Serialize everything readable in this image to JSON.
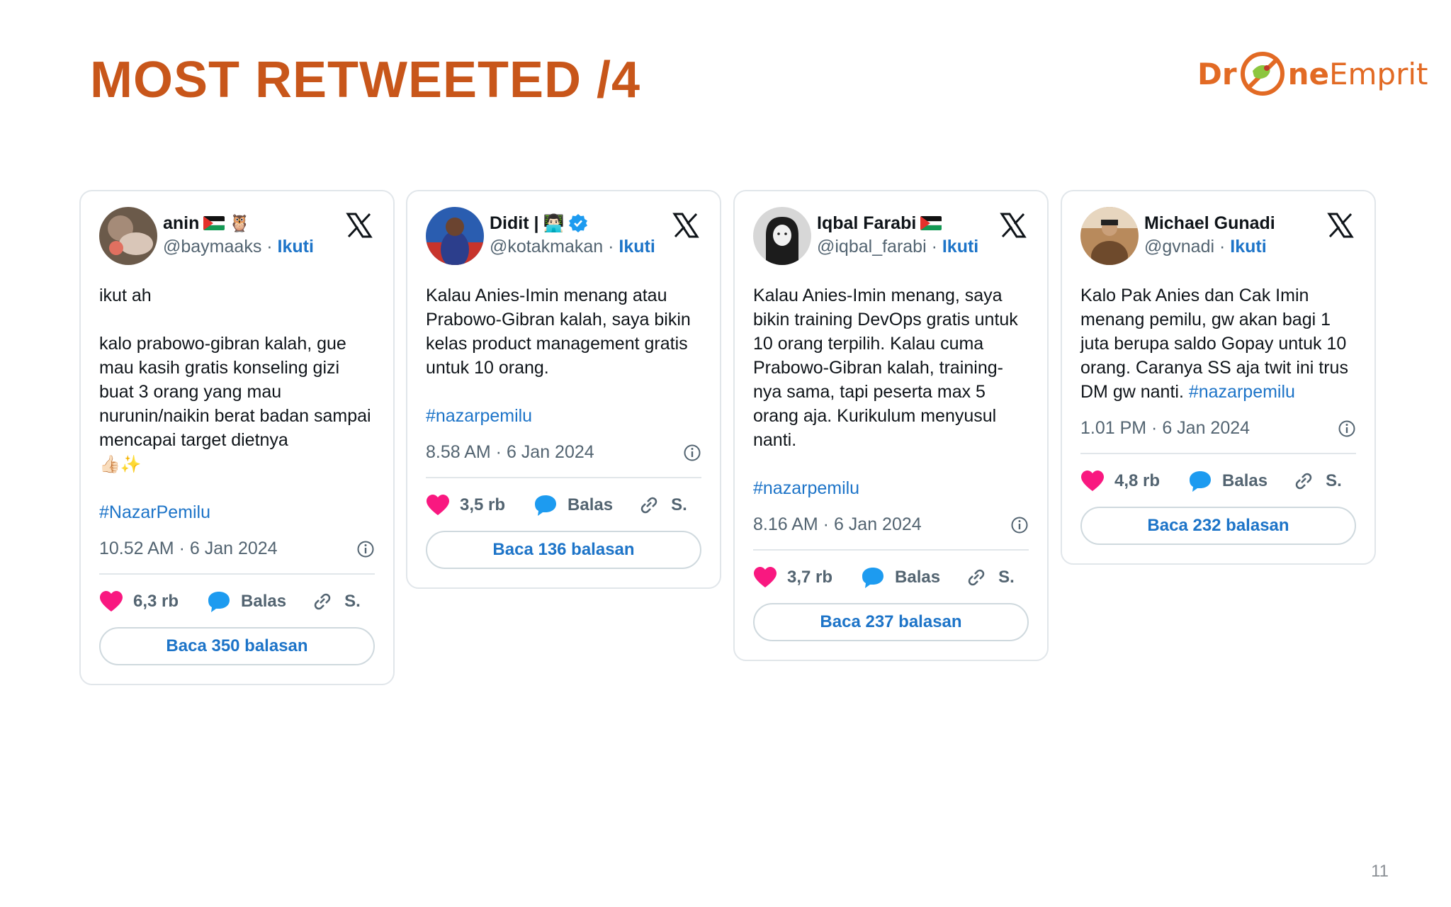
{
  "slide": {
    "title": "MOST RETWEETED /4",
    "page_number": "11",
    "logo": {
      "part1": "Dr",
      "part2": "ne",
      "part3": "Emprit"
    }
  },
  "colors": {
    "title": "#c8561a",
    "link": "#1d74c8",
    "like": "#f91880",
    "reply": "#1d9bf0"
  },
  "tweets": [
    {
      "name": "anin",
      "name_emoji": "🦉",
      "handle": "@baymaaks",
      "follow_label": "Ikuti",
      "text": "ikut ah\n\nkalo prabowo-gibran kalah, gue mau kasih gratis konseling gizi buat 3 orang yang mau nurunin/naikin berat badan sampai mencapai target dietnya",
      "text_emoji": "👍🏻✨",
      "hashtag": "#NazarPemilu",
      "timestamp": "10.52 AM · 6 Jan 2024",
      "likes": "6,3 rb",
      "reply_label": "Balas",
      "copy_label": "S.",
      "read_replies": "Baca 350 balasan"
    },
    {
      "name": "Didit |",
      "name_emoji": "👨🏻‍💻",
      "handle": "@kotakmakan",
      "follow_label": "Ikuti",
      "text": "Kalau Anies-Imin menang atau Prabowo-Gibran kalah, saya bikin kelas product management gratis untuk 10 orang.",
      "hashtag": "#nazarpemilu",
      "timestamp": "8.58 AM · 6 Jan 2024",
      "likes": "3,5 rb",
      "reply_label": "Balas",
      "copy_label": "S.",
      "read_replies": "Baca 136 balasan"
    },
    {
      "name": "Iqbal Farabi",
      "handle": "@iqbal_farabi",
      "follow_label": "Ikuti",
      "text": "Kalau Anies-Imin menang, saya bikin training DevOps gratis untuk 10 orang terpilih. Kalau cuma Prabowo-Gibran kalah, training-nya sama, tapi peserta max 5 orang aja. Kurikulum menyusul nanti.",
      "hashtag": "#nazarpemilu",
      "timestamp": "8.16 AM · 6 Jan 2024",
      "likes": "3,7 rb",
      "reply_label": "Balas",
      "copy_label": "S.",
      "read_replies": "Baca 237 balasan"
    },
    {
      "name": "Michael Gunadi",
      "handle": "@gvnadi",
      "follow_label": "Ikuti",
      "text": "Kalo Pak Anies dan Cak Imin menang pemilu, gw akan bagi 1 juta berupa saldo Gopay untuk 10 orang. Caranya SS aja twit ini trus DM gw nanti.",
      "hashtag": "#nazarpemilu",
      "timestamp": "1.01 PM · 6 Jan 2024",
      "likes": "4,8 rb",
      "reply_label": "Balas",
      "copy_label": "S.",
      "read_replies": "Baca 232 balasan"
    }
  ]
}
